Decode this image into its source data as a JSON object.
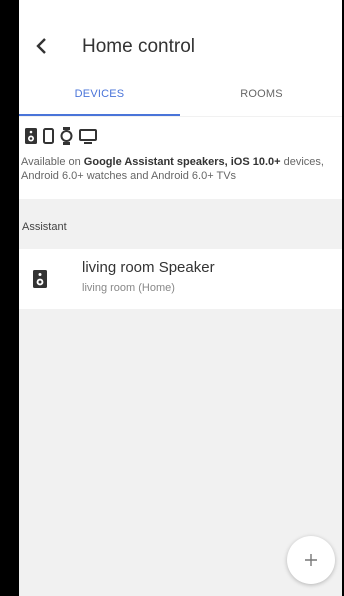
{
  "header": {
    "title": "Home control",
    "back_icon": "chevron-left-icon"
  },
  "tabs": [
    {
      "label": "DEVICES",
      "active": true
    },
    {
      "label": "ROOMS",
      "active": false
    }
  ],
  "availability": {
    "icons": [
      "speaker-icon",
      "phone-icon",
      "watch-icon",
      "tv-icon"
    ],
    "text_prefix": "Available on ",
    "text_bold": "Google Assistant speakers, iOS 10.0+",
    "text_rest": " devices, Android 6.0+ watches and Android 6.0+ TVs"
  },
  "section": {
    "label": "Assistant"
  },
  "devices": [
    {
      "name": "living room Speaker",
      "location": "living room (Home)",
      "icon": "speaker-icon"
    }
  ],
  "fab": {
    "icon": "plus-icon"
  },
  "colors": {
    "accent": "#4a74d9",
    "background": "#f1f1f1",
    "surface": "#ffffff"
  }
}
